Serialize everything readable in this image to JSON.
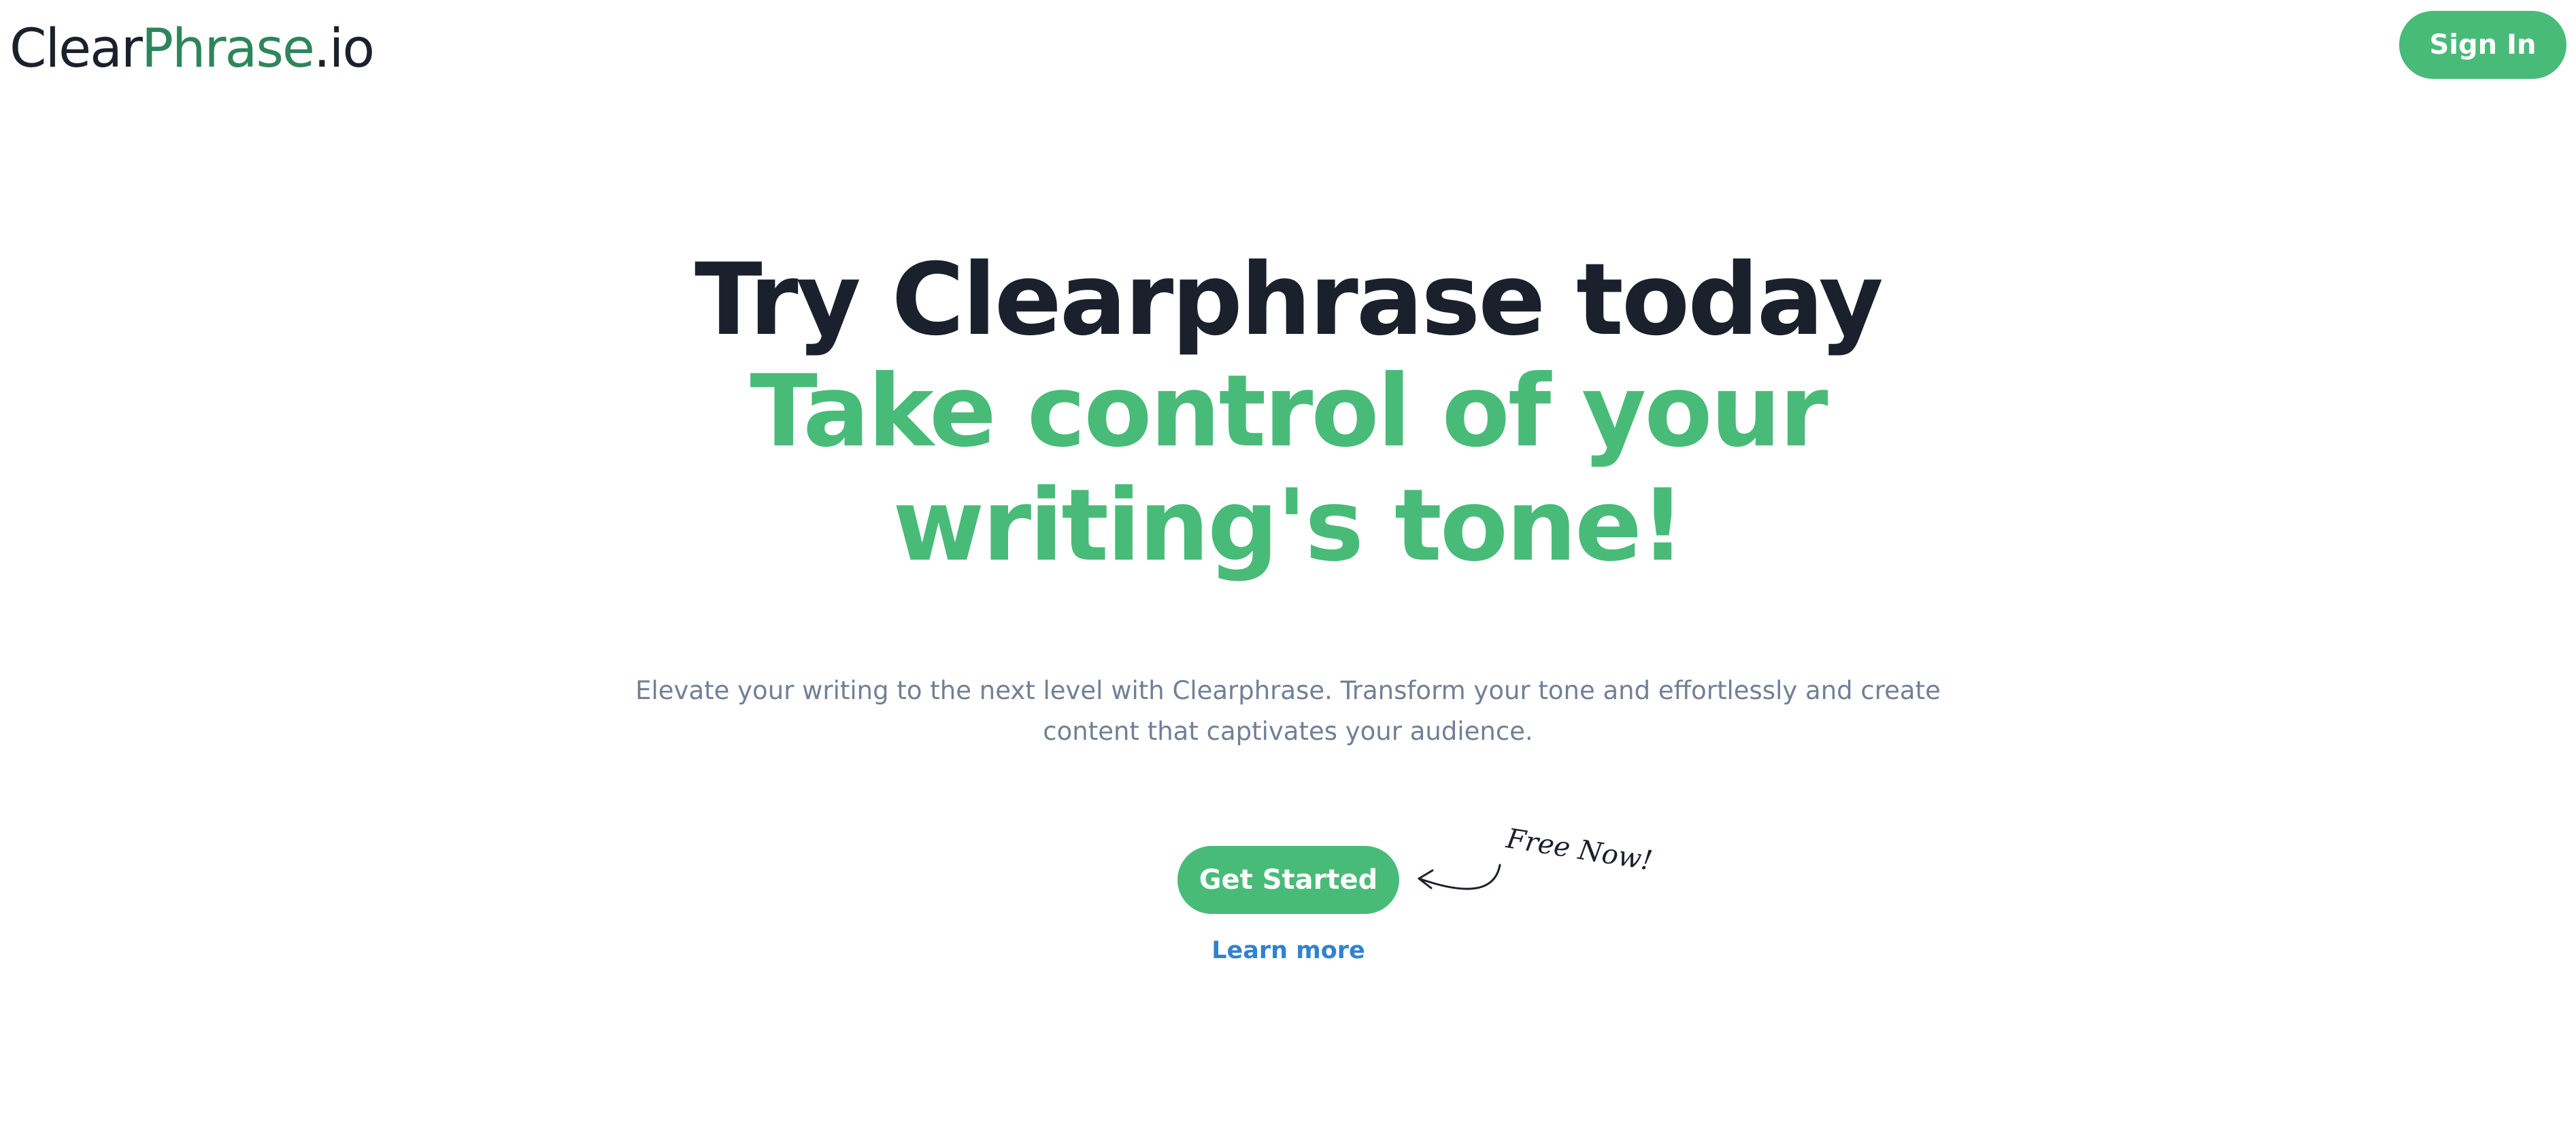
{
  "header": {
    "logo": {
      "part1": "Clear",
      "part2": "Phrase",
      "part3": ".io"
    },
    "signin_label": "Sign In"
  },
  "hero": {
    "title_line1": "Try Clearphrase today",
    "title_line2": "Take control of your",
    "title_line3": "writing's tone!",
    "subtitle_line1": "Elevate your writing to the next level with Clearphrase. Transform your tone and effortlessly and create",
    "subtitle_line2": "content that captivates your audience.",
    "cta_label": "Get Started",
    "learn_more_label": "Learn more",
    "callout": "Free Now!"
  },
  "colors": {
    "brand_green": "#48bb78",
    "logo_green": "#2f855a",
    "text_dark": "#1a202c",
    "text_muted": "#718096",
    "link_blue": "#3182ce"
  },
  "icons": {
    "callout_arrow": "curved-arrow-icon"
  }
}
